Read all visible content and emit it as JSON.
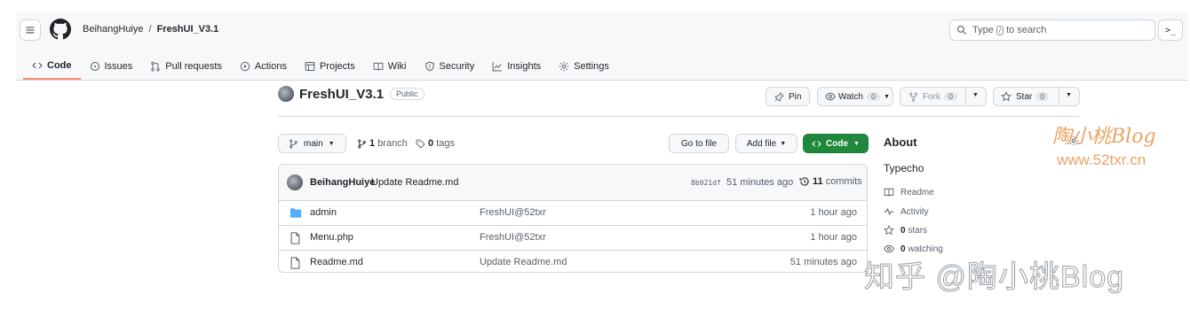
{
  "header": {
    "owner": "BeihangHuiye",
    "separator": "/",
    "repo": "FreshUI_V3.1",
    "search_pre": "Type",
    "search_key": "/",
    "search_post": "to search",
    "terminal_label": ">_"
  },
  "tabs": [
    {
      "label": "Code",
      "icon": "code-icon"
    },
    {
      "label": "Issues",
      "icon": "issue-icon"
    },
    {
      "label": "Pull requests",
      "icon": "pull-request-icon"
    },
    {
      "label": "Actions",
      "icon": "play-icon"
    },
    {
      "label": "Projects",
      "icon": "table-icon"
    },
    {
      "label": "Wiki",
      "icon": "book-icon"
    },
    {
      "label": "Security",
      "icon": "shield-icon"
    },
    {
      "label": "Insights",
      "icon": "graph-icon"
    },
    {
      "label": "Settings",
      "icon": "gear-icon"
    }
  ],
  "repo": {
    "title": "FreshUI_V3.1",
    "visibility": "Public",
    "pin_label": "Pin",
    "watch_label": "Watch",
    "watch_count": "0",
    "fork_label": "Fork",
    "fork_count": "0",
    "star_label": "Star",
    "star_count": "0"
  },
  "filenav": {
    "branch": "main",
    "branches_count": "1",
    "branches_label": "branch",
    "tags_count": "0",
    "tags_label": "tags",
    "go_to_file": "Go to file",
    "add_file": "Add file",
    "code": "Code"
  },
  "commit": {
    "author": "BeihangHuiye",
    "message": "Update Readme.md",
    "sha": "8b921df",
    "time": "51 minutes ago",
    "commits_count": "11",
    "commits_label": "commits"
  },
  "files": [
    {
      "name": "admin",
      "type": "folder",
      "message": "FreshUI@52txr",
      "time": "1 hour ago"
    },
    {
      "name": "Menu.php",
      "type": "file",
      "message": "FreshUI@52txr",
      "time": "1 hour ago"
    },
    {
      "name": "Readme.md",
      "type": "file",
      "message": "Update Readme.md",
      "time": "51 minutes ago"
    }
  ],
  "about": {
    "title": "About",
    "description": "Typecho",
    "readme": "Readme",
    "activity": "Activity",
    "stars_count": "0",
    "stars_label": "stars",
    "watching_count": "0",
    "watching_label": "watching"
  },
  "watermark": {
    "brand": "陶小桃Blog",
    "site": "www.52txr.cn",
    "zhihu": "知乎 @陶小桃Blog"
  },
  "colors": {
    "accent_tab": "#fd8c73",
    "primary_green": "#1f883d",
    "folder_blue": "#54aeff",
    "watermark_orange": "#e8934a"
  }
}
